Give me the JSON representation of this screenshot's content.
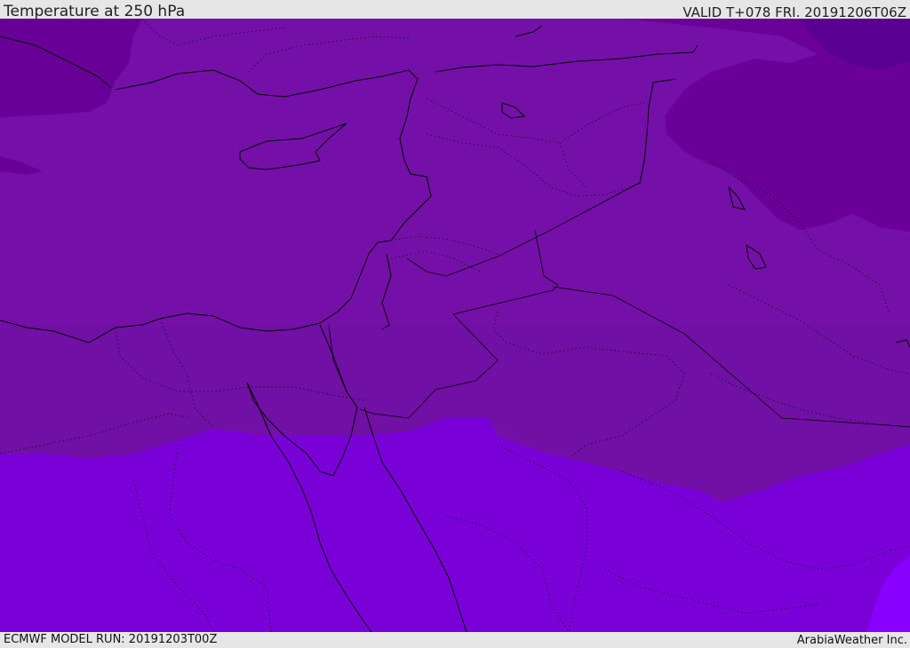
{
  "header": {
    "title": "Temperature at 250 hPa",
    "valid": "VALID T+078 FRI. 20191206T06Z"
  },
  "footer": {
    "model_run": "ECMWF MODEL RUN: 20191203T00Z",
    "credit": "ArabiaWeather Inc."
  },
  "map": {
    "variable": "temperature",
    "level": "250 hPa",
    "fill_colors": {
      "darkest": "#5a0090",
      "dark": "#6c0098",
      "medium": "#7810ac",
      "base": "#7410a8",
      "light": "#7a00d8",
      "lightest": "#8a00ff"
    },
    "coastline_color": "#000000"
  }
}
